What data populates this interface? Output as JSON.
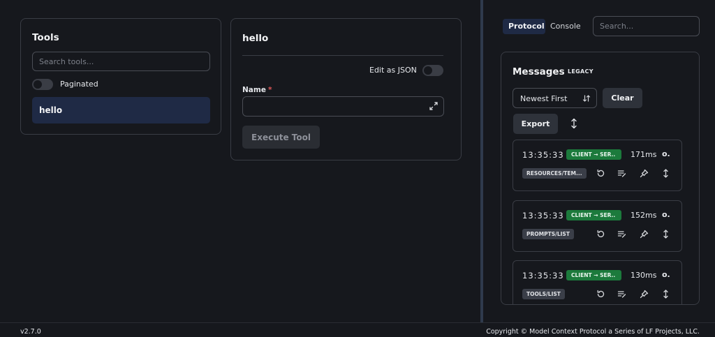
{
  "tools": {
    "title": "Tools",
    "search_placeholder": "Search tools...",
    "paginated_label": "Paginated",
    "items": [
      {
        "label": "hello"
      }
    ]
  },
  "tool_detail": {
    "title": "hello",
    "edit_json_label": "Edit as JSON",
    "name_label": "Name",
    "required_mark": "*",
    "name_value": "",
    "execute_label": "Execute Tool"
  },
  "right": {
    "tabs": [
      {
        "label": "Protocol",
        "active": true
      },
      {
        "label": "Console",
        "active": false
      }
    ],
    "search_placeholder": "Search..."
  },
  "messages": {
    "title": "Messages",
    "badge": "LEGACY",
    "sort_value": "Newest First",
    "clear_label": "Clear",
    "export_label": "Export",
    "items": [
      {
        "time": "13:35:33",
        "direction": "CLIENT → SER..",
        "duration": "171ms",
        "more": "o.",
        "method": "RESOURCES/TEM..."
      },
      {
        "time": "13:35:33",
        "direction": "CLIENT → SER..",
        "duration": "152ms",
        "more": "o.",
        "method": "PROMPTS/LIST"
      },
      {
        "time": "13:35:33",
        "direction": "CLIENT → SER..",
        "duration": "130ms",
        "more": "o.",
        "method": "TOOLS/LIST"
      }
    ]
  },
  "footer": {
    "version": "v2.7.0",
    "copyright": "Copyright © Model Context Protocol a Series of LF Projects, LLC."
  },
  "colors": {
    "background": "#16181d",
    "accent": "#1f2a45",
    "success": "#1c7a3c",
    "required": "#e05858"
  },
  "icons": [
    "expand-icon",
    "sort-icon",
    "expand-vertical-icon",
    "replay-icon",
    "edit-list-icon",
    "pin-icon"
  ]
}
